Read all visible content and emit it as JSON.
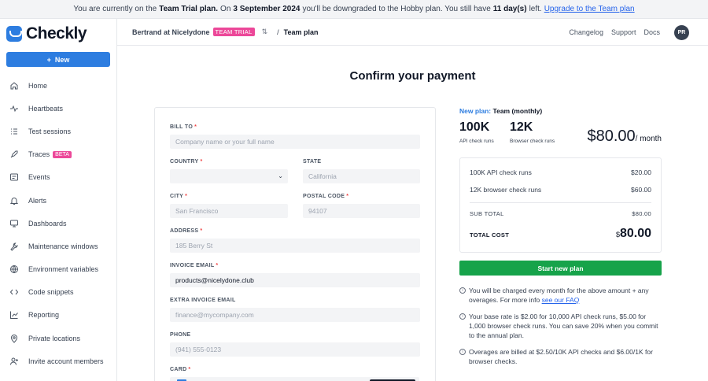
{
  "banner": {
    "p1": "You are currently on the",
    "plan": "Team Trial plan.",
    "p2": "On",
    "date": "3 September 2024",
    "p3": "you'll be downgraded to the Hobby plan. You still have",
    "days": "11 day(s)",
    "p4": "left.",
    "link": "Upgrade to the Team plan"
  },
  "sidebar": {
    "logo": "Checkly",
    "new_label": "New",
    "items": [
      {
        "label": "Home",
        "icon": "home-icon"
      },
      {
        "label": "Heartbeats",
        "icon": "heartbeat-icon"
      },
      {
        "label": "Test sessions",
        "icon": "list-icon"
      },
      {
        "label": "Traces",
        "icon": "rocket-icon",
        "badge": "BETA"
      },
      {
        "label": "Events",
        "icon": "events-icon"
      },
      {
        "label": "Alerts",
        "icon": "bell-icon"
      },
      {
        "label": "Dashboards",
        "icon": "monitor-icon"
      },
      {
        "label": "Maintenance windows",
        "icon": "wrench-icon"
      },
      {
        "label": "Environment variables",
        "icon": "globe-icon"
      },
      {
        "label": "Code snippets",
        "icon": "code-icon"
      },
      {
        "label": "Reporting",
        "icon": "chart-icon"
      },
      {
        "label": "Private locations",
        "icon": "location-icon"
      },
      {
        "label": "Invite account members",
        "icon": "add-user-icon"
      }
    ]
  },
  "topbar": {
    "account": "Bertrand at Nicelydone",
    "badge": "TEAM TRIAL",
    "separator": "/",
    "page": "Team plan",
    "links": [
      "Changelog",
      "Support",
      "Docs"
    ],
    "avatar": "PR"
  },
  "page_title": "Confirm your payment",
  "form": {
    "bill_to": {
      "label": "BILL TO",
      "placeholder": "Company name or your full name"
    },
    "country": {
      "label": "COUNTRY",
      "value": ""
    },
    "state": {
      "label": "STATE",
      "placeholder": "California"
    },
    "city": {
      "label": "CITY",
      "placeholder": "San Francisco"
    },
    "postal": {
      "label": "POSTAL CODE",
      "placeholder": "94107"
    },
    "address": {
      "label": "ADDRESS",
      "placeholder": "185 Berry St"
    },
    "invoice_email": {
      "label": "INVOICE EMAIL",
      "value": "products@nicelydone.club"
    },
    "extra_email": {
      "label": "EXTRA INVOICE EMAIL",
      "placeholder": "finance@mycompany.com"
    },
    "phone": {
      "label": "PHONE",
      "placeholder": "(941) 555-0123"
    },
    "card": {
      "label": "CARD"
    },
    "required_mark": "*"
  },
  "summary": {
    "plan_prefix": "New plan:",
    "plan_name": "Team (monthly)",
    "api_runs": "100K",
    "api_runs_label": "API check runs",
    "browser_runs": "12K",
    "browser_runs_label": "Browser check runs",
    "price": "$80.00",
    "price_period": "/ month",
    "lines": [
      {
        "label": "100K API check runs",
        "amount": "$20.00"
      },
      {
        "label": "12K browser check runs",
        "amount": "$60.00"
      }
    ],
    "subtotal_label": "SUB TOTAL",
    "subtotal": "$80.00",
    "total_label": "TOTAL COST",
    "total_currency": "$",
    "total": "80.00",
    "button": "Start new plan",
    "notes": [
      {
        "text": "You will be charged every month for the above amount + any overages. For more info",
        "link": "see our FAQ"
      },
      {
        "text": "Your base rate is $2.00 for 10,000 API check runs, $5.00 for 1,000 browser check runs. You can save 20% when you commit to the annual plan."
      },
      {
        "text": "Overages are billed at $2.50/10K API checks and $6.00/1K for browser checks."
      }
    ]
  },
  "colors": {
    "accent": "#2d7de0",
    "badge": "#ec4899",
    "success": "#16a34a"
  }
}
